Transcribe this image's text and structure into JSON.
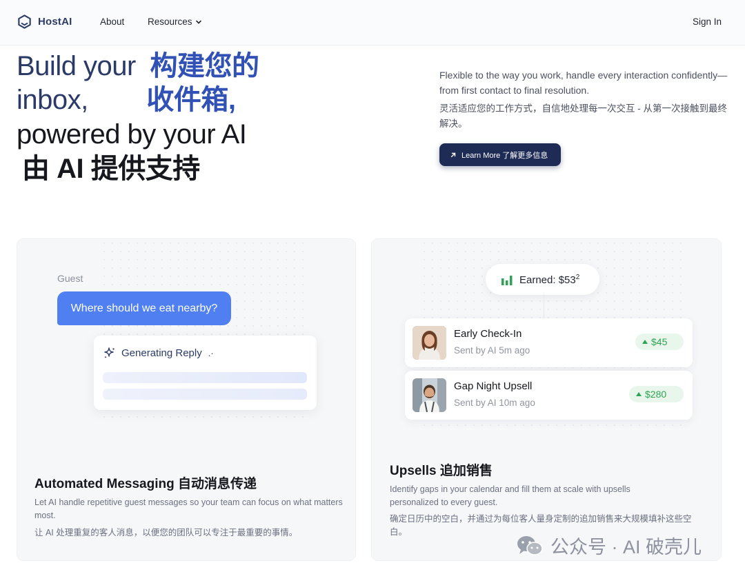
{
  "nav": {
    "brand": "HostAI",
    "about": "About",
    "resources": "Resources",
    "sign_in": "Sign In"
  },
  "hero": {
    "line1_en": "Build your",
    "line1_cn": "构建您的",
    "line2_en": "inbox,",
    "line2_cn": "收件箱,",
    "line3_en": "powered by your AI",
    "line4_cn": "由 AI 提供支持",
    "desc_en": "Flexible to the way you work, handle every interaction confidently—from first contact to final resolution.",
    "desc_cn": "灵活适应您的工作方式，自信地处理每一次交互 - 从第一次接触到最终解决。",
    "learn_more": "Learn More 了解更多信息"
  },
  "messaging_card": {
    "guest_label": "Guest",
    "guest_message": "Where should we eat nearby?",
    "generating": "Generating Reply",
    "generating_dots": ".·",
    "title": "Automated Messaging 自动消息传递",
    "desc_en": "Let AI handle repetitive guest messages so your team can focus on what matters most.",
    "desc_cn": "让 AI 处理重复的客人消息，以便您的团队可以专注于最重要的事情。"
  },
  "upsells_card": {
    "earned_label": "Earned: $53",
    "earned_sup": "2",
    "items": [
      {
        "name": "Early Check-In",
        "sub": "Sent by AI 5m ago",
        "amount": "$45"
      },
      {
        "name": "Gap Night Upsell",
        "sub": "Sent by AI 10m ago",
        "amount": "$280"
      }
    ],
    "title": "Upsells 追加销售",
    "desc_en": "Identify gaps in your calendar and fill them at scale with upsells personalized to every guest.",
    "desc_cn": "确定日历中的空白，并通过为每位客人量身定制的追加销售来大规模填补这些空白。"
  },
  "watermark": {
    "text": "公众号 · AI 破壳儿"
  },
  "colors": {
    "brand_navy": "#2b3a67",
    "accent_blue": "#3151b5",
    "bubble_blue": "#4f7ff0",
    "button_navy": "#1e2b55",
    "success_green": "#2ea352"
  }
}
